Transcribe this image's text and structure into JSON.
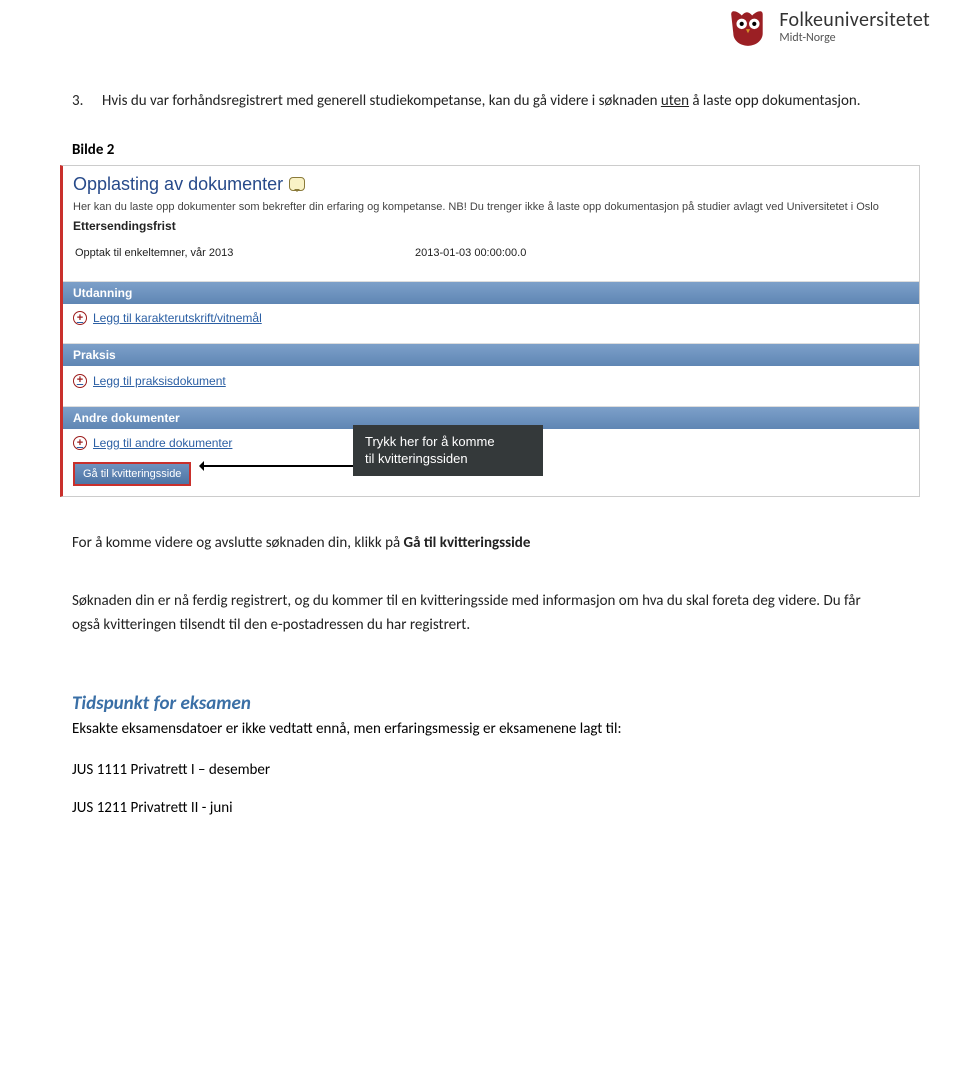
{
  "logo": {
    "name": "Folkeuniversitetet",
    "sub": "Midt-Norge"
  },
  "step": {
    "num": "3.",
    "text_prefix": "Hvis du var forhåndsregistrert med generell studiekompetanse, kan du gå videre i søknaden ",
    "text_under": "uten",
    "text_suffix": " å laste opp dokumentasjon."
  },
  "bilde_label": "Bilde 2",
  "shot": {
    "title": "Opplasting av dokumenter",
    "desc": "Her kan du laste opp dokumenter som bekrefter din erfaring og kompetanse. NB! Du trenger ikke å laste opp dokumentasjon på studier avlagt ved Universitetet i Oslo",
    "frist_label": "Ettersendingsfrist",
    "opptak_label": "Opptak til enkeltemner, vår 2013",
    "opptak_date": "2013-01-03 00:00:00.0",
    "sections": {
      "utdanning": {
        "title": "Utdanning",
        "link": "Legg til karakterutskrift/vitnemål"
      },
      "praksis": {
        "title": "Praksis",
        "link": "Legg til praksisdokument"
      },
      "andre": {
        "title": "Andre dokumenter",
        "link": "Legg til andre dokumenter"
      }
    },
    "button": "Gå til kvitteringsside",
    "tooltip_l1": "Trykk her for å komme",
    "tooltip_l2": "til kvitteringssiden"
  },
  "para1": {
    "prefix": "For å komme videre og avslutte søknaden din, klikk på ",
    "bold": "Gå til kvitteringsside"
  },
  "para2": "Søknaden din er nå ferdig registrert, og du kommer til en kvitteringsside med informasjon om hva du skal foreta deg videre. Du får også kvitteringen tilsendt til den e-postadressen du har registrert.",
  "exam_heading": "Tidspunkt for eksamen",
  "exam_para": "Eksakte eksamensdatoer er ikke vedtatt ennå, men erfaringsmessig er eksamenene lagt til:",
  "exam_line1": "JUS 1111 Privatrett I – desember",
  "exam_line2": "JUS 1211 Privatrett II  - juni"
}
